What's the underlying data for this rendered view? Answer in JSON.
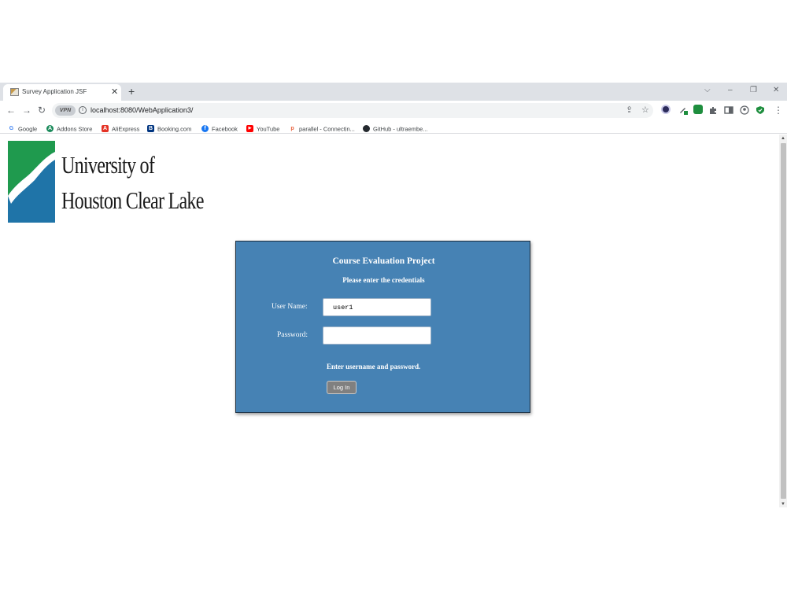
{
  "browser": {
    "tab": {
      "title": "Survey Application JSF",
      "close": "✕"
    },
    "new_tab": "+",
    "window_controls": {
      "tab_search": "⌵",
      "minimize": "–",
      "restore": "❐",
      "close": "✕"
    },
    "nav": {
      "back": "←",
      "forward": "→",
      "reload": "↻"
    },
    "address": {
      "vpn_badge": "VPN",
      "url": "localhost:8080/WebApplication3/"
    },
    "omnibox_icons": {
      "share": "⇪",
      "bookmark_star": "☆"
    },
    "menu": "⋮",
    "bookmarks": [
      {
        "label": "Google",
        "icon": "google-icon",
        "color": "#4285f4",
        "glyph": "G"
      },
      {
        "label": "Addons Store",
        "icon": "addons-store-icon",
        "color": "#1a8a5a",
        "glyph": "A"
      },
      {
        "label": "AliExpress",
        "icon": "aliexpress-icon",
        "color": "#e43225",
        "glyph": "A"
      },
      {
        "label": "Booking.com",
        "icon": "booking-icon",
        "color": "#003580",
        "glyph": "B"
      },
      {
        "label": "Facebook",
        "icon": "facebook-icon",
        "color": "#1877f2",
        "glyph": "f"
      },
      {
        "label": "YouTube",
        "icon": "youtube-icon",
        "color": "#ff0000",
        "glyph": "▶"
      },
      {
        "label": "parallel - Connectin...",
        "icon": "parallel-icon",
        "color": "#e8603c",
        "glyph": "p"
      },
      {
        "label": "GitHub - ultraembe...",
        "icon": "github-icon",
        "color": "#24292e",
        "glyph": "●"
      }
    ]
  },
  "page": {
    "logo": {
      "line1": "University of",
      "line2": "Houston Clear Lake",
      "colors": {
        "green": "#1f9a4e",
        "blue": "#1f74a8"
      }
    },
    "login": {
      "title": "Course Evaluation Project",
      "subtitle": "Please enter the credentials",
      "username_label": "User Name:",
      "username_value": "user1",
      "password_label": "Password:",
      "password_value": "",
      "message": "Enter username and password.",
      "login_button": "Log In",
      "panel_color": "#4682b4"
    }
  }
}
